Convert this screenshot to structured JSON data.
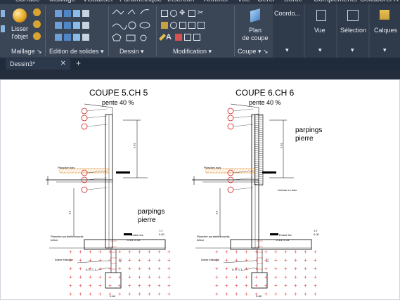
{
  "menubar": [
    "Surface",
    "Maillage",
    "Visualiser",
    "Paramétrique",
    "Insertion",
    "Annoter",
    "Vue",
    "Gérer",
    "Sortie",
    "Compléments",
    "Collaborer",
    "A"
  ],
  "ribbon": {
    "lisser_label": "Lisser\nl'objet",
    "panels": {
      "maillage": "Maillage",
      "edition": "Edition de solides",
      "dessin": "Dessin",
      "modification": "Modification",
      "coupe": "Coupe"
    },
    "plan_coupe_label": "Plan\nde coupe",
    "coordo_label": "Coordo...",
    "vue_label": "Vue",
    "selection_label": "Sélection",
    "calques_label": "Calques"
  },
  "tabs": [
    {
      "label": "Dessin3*"
    }
  ],
  "drawing": {
    "left": {
      "title": "COUPE 5.CH 5",
      "pente": "pente 40 %",
      "parpings": "parpings\npierre",
      "plancher": "Plancher bois",
      "plancher2": "Plancher poutrelle hourdis\nbéton",
      "arase": "Arase étanche",
      "as": "A.S.-1.1",
      "cote_tt": "T.T\n0.00",
      "cote_tn": "-0.15  -0.15",
      "etanchure": "Enduit fini",
      "dim1": "3.5",
      "dim2": "0.2",
      "dim3": "2.41"
    },
    "right": {
      "title": "COUPE 6.CH 6",
      "pente": "pente 40 %",
      "parpings": "parpings\npierre",
      "plancher": "Plancher bois",
      "plancher2": "Plancher poutrelle hourdis\nbéton",
      "arase": "Arase étanche",
      "as": "A.S.-1.1",
      "cote_tt": "T.T\n0.00",
      "cote_tn": "-0.15  -0.15",
      "linteau": "Linteau en bois",
      "etanchure": "Enduit fini",
      "dim1": "3.5",
      "dim2": "0.2",
      "dim3": "2.41"
    },
    "bottom_dim": "0.88"
  },
  "colors": {
    "ribbon_bg": "#3a4556",
    "canvas_bg": "#ffffff",
    "marker_red": "#d62020",
    "hatch_orange": "#e07a00",
    "plus_red": "#e04848"
  }
}
